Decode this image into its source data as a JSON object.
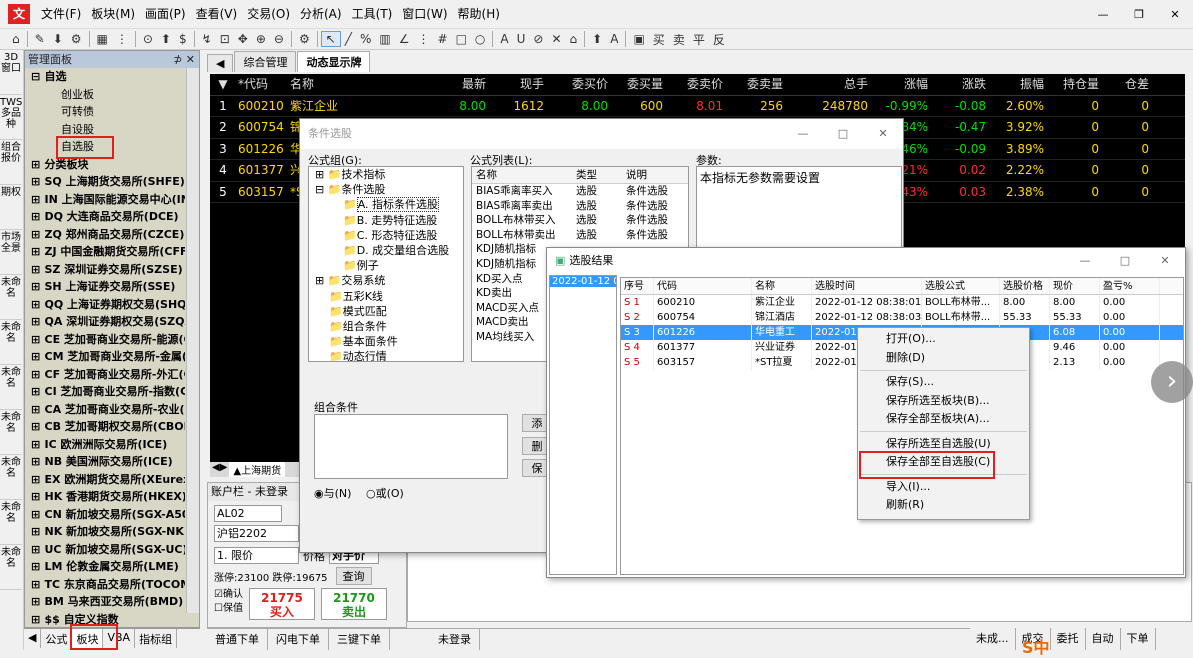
{
  "app": {
    "logo": "文"
  },
  "menu": [
    "文件(F)",
    "板块(M)",
    "画面(P)",
    "查看(V)",
    "交易(O)",
    "分析(A)",
    "工具(T)",
    "窗口(W)",
    "帮助(H)"
  ],
  "toolbar": [
    "⌂",
    "✎",
    "⬇",
    "⚙",
    "▦",
    "⋮",
    "⊙",
    "⬆",
    "$",
    "↯",
    "⊡",
    "✥",
    "⊕",
    "⊖",
    "⚙",
    "↖",
    "╱",
    "%",
    "▥",
    "∠",
    "⋮",
    "#",
    "□",
    "○",
    "A",
    "U",
    "⊘",
    "✕",
    "⌂",
    "⬆",
    "A",
    "▣",
    "买",
    "卖",
    "平",
    "反"
  ],
  "vtabs": [
    "3D窗口",
    "TWS多品种",
    "组合报价",
    "期权",
    "市场全景",
    "未命名",
    "未命名",
    "未命名",
    "未命名",
    "未命名",
    "未命名",
    "未命名"
  ],
  "panel": {
    "title": "管理面板",
    "pin": "⊅ ✕",
    "tree": [
      {
        "t": "自选",
        "ex": "⊟",
        "lvl": 0
      },
      {
        "t": "创业板",
        "lvl": 1
      },
      {
        "t": "可转债",
        "lvl": 1
      },
      {
        "t": "自设股",
        "lvl": 1
      },
      {
        "t": "自选股",
        "lvl": 1
      },
      {
        "t": "分类板块",
        "ex": "⊞",
        "lvl": 0
      },
      {
        "t": "SQ 上海期货交易所(SHFE)",
        "ex": "⊞",
        "lvl": 0
      },
      {
        "t": "IN 上海国际能源交易中心(INE)",
        "ex": "⊞",
        "lvl": 0
      },
      {
        "t": "DQ 大连商品交易所(DCE)",
        "ex": "⊞",
        "lvl": 0
      },
      {
        "t": "ZQ 郑州商品交易所(CZCE)",
        "ex": "⊞",
        "lvl": 0
      },
      {
        "t": "ZJ 中国金融期货交易所(CFFEX)",
        "ex": "⊞",
        "lvl": 0
      },
      {
        "t": "SZ 深圳证券交易所(SZSE)",
        "ex": "⊞",
        "lvl": 0
      },
      {
        "t": "SH 上海证券交易所(SSE)",
        "ex": "⊞",
        "lvl": 0
      },
      {
        "t": "QQ 上海证券期权交易(SHQQ)",
        "ex": "⊞",
        "lvl": 0
      },
      {
        "t": "QA 深圳证券期权交易(SZQA)",
        "ex": "⊞",
        "lvl": 0
      },
      {
        "t": "CE 芝加哥商业交易所-能源(CM",
        "ex": "⊞",
        "lvl": 0
      },
      {
        "t": "CM 芝加哥商业交易所-金属(CM",
        "ex": "⊞",
        "lvl": 0
      },
      {
        "t": "CF 芝加哥商业交易所-外汇(CM",
        "ex": "⊞",
        "lvl": 0
      },
      {
        "t": "CI 芝加哥商业交易所-指数(CM",
        "ex": "⊞",
        "lvl": 0
      },
      {
        "t": "CA 芝加哥商业交易所-农业(CM",
        "ex": "⊞",
        "lvl": 0
      },
      {
        "t": "CB 芝加哥期权交易所(CBOE)",
        "ex": "⊞",
        "lvl": 0
      },
      {
        "t": "IC 欧洲洲际交易所(ICE)",
        "ex": "⊞",
        "lvl": 0
      },
      {
        "t": "NB 美国洲际交易所(ICE)",
        "ex": "⊞",
        "lvl": 0
      },
      {
        "t": "EX 欧洲期货交易所(XEurex)",
        "ex": "⊞",
        "lvl": 0
      },
      {
        "t": "HK 香港期货交易所(HKEX)",
        "ex": "⊞",
        "lvl": 0
      },
      {
        "t": "CN 新加坡交易所(SGX-A50)",
        "ex": "⊞",
        "lvl": 0
      },
      {
        "t": "NK 新加坡交易所(SGX-NK)",
        "ex": "⊞",
        "lvl": 0
      },
      {
        "t": "UC 新加坡交易所(SGX-UC)",
        "ex": "⊞",
        "lvl": 0
      },
      {
        "t": "LM 伦敦金属交易所(LME)",
        "ex": "⊞",
        "lvl": 0
      },
      {
        "t": "TC 东京商品交易所(TOCOM)",
        "ex": "⊞",
        "lvl": 0
      },
      {
        "t": "BM 马来西亚交易所(BMD)",
        "ex": "⊞",
        "lvl": 0
      },
      {
        "t": "$$ 自定义指数",
        "ex": "⊞",
        "lvl": 0
      }
    ],
    "tabs": [
      "公式",
      "板块",
      "VBA",
      "指标组"
    ]
  },
  "maintabs": [
    "综合管理",
    "动态显示牌"
  ],
  "grid": {
    "headers": [
      "▼",
      "*代码",
      "名称",
      "最新",
      "现手",
      "委买价",
      "委买量",
      "委卖价",
      "委卖量",
      "总手",
      "涨幅",
      "涨跌",
      "振幅",
      "持仓量",
      "仓差"
    ],
    "rows": [
      [
        "1",
        "600210",
        "紫江企业",
        "8.00",
        "1612",
        "8.00",
        "600",
        "8.01",
        "256",
        "248780",
        "-0.99%",
        "-0.08",
        "2.60%",
        "0",
        "0"
      ],
      [
        "2",
        "600754",
        "锦江酒店",
        "",
        "",
        "",
        "",
        "",
        "",
        "",
        "-0.84%",
        "-0.47",
        "3.92%",
        "0",
        "0"
      ],
      [
        "3",
        "601226",
        "华电重工",
        "",
        "",
        "",
        "",
        "",
        "",
        "",
        "-1.46%",
        "-0.09",
        "3.89%",
        "0",
        "0"
      ],
      [
        "4",
        "601377",
        "兴业证券",
        "",
        "",
        "",
        "",
        "",
        "",
        "",
        "0.21%",
        "0.02",
        "2.22%",
        "0",
        "0"
      ],
      [
        "5",
        "603157",
        "*ST拉夏",
        "",
        "",
        "",
        "",
        "",
        "",
        "",
        "1.43%",
        "0.03",
        "2.38%",
        "0",
        "0"
      ]
    ],
    "frag": [
      "0",
      "0",
      "5",
      "1",
      "8"
    ],
    "subtab": "▲上海期货"
  },
  "account": {
    "title": "账户栏 - 未登录",
    "code": "AL02",
    "name": "沪铝2202",
    "ordertype": "1. 限价",
    "price_label": "价格",
    "price_val": "对手价",
    "limit": "涨停:23100 跌停:19675",
    "query": "查询",
    "confirm": "确认",
    "keep": "保值",
    "buy_price": "21775",
    "sell_price": "21770",
    "buy": "买入",
    "sell": "卖出"
  },
  "bottabs": [
    "普通下单",
    "闪电下单",
    "三键下单",
    "未登录"
  ],
  "righttabs": [
    "未成...",
    "成交",
    "委托",
    "自动",
    "下单"
  ],
  "cond": {
    "title": "条件选股",
    "group_label": "公式组(G):",
    "list_label": "公式列表(L):",
    "param_label": "参数:",
    "param_text": "本指标无参数需要设置",
    "combo_label": "组合条件",
    "and": "与(N)",
    "or": "或(O)",
    "add": "添",
    "del": "删",
    "save": "保",
    "groups": [
      {
        "t": "技术指标",
        "l": 1,
        "ex": "⊞"
      },
      {
        "t": "条件选股",
        "l": 1,
        "ex": "⊟"
      },
      {
        "t": "A. 指标条件选股",
        "l": 3
      },
      {
        "t": "B. 走势特征选股",
        "l": 3
      },
      {
        "t": "C. 形态特征选股",
        "l": 3
      },
      {
        "t": "D. 成交量组合选股",
        "l": 3
      },
      {
        "t": "例子",
        "l": 3
      },
      {
        "t": "交易系统",
        "l": 1,
        "ex": "⊞"
      },
      {
        "t": "五彩K线",
        "l": 2
      },
      {
        "t": "模式匹配",
        "l": 2
      },
      {
        "t": "组合条件",
        "l": 2
      },
      {
        "t": "基本面条件",
        "l": 2
      },
      {
        "t": "动态行情",
        "l": 2
      }
    ],
    "list_headers": [
      "名称",
      "类型",
      "说明"
    ],
    "list": [
      [
        "BIAS乖离率买入",
        "选股",
        "条件选股"
      ],
      [
        "BIAS乖离率卖出",
        "选股",
        "条件选股"
      ],
      [
        "BOLL布林带买入",
        "选股",
        "条件选股"
      ],
      [
        "BOLL布林带卖出",
        "选股",
        "条件选股"
      ],
      [
        "KDJ随机指标",
        "",
        ""
      ],
      [
        "KDJ随机指标",
        "",
        ""
      ],
      [
        "KD买入点",
        "",
        ""
      ],
      [
        "KD卖出",
        "",
        ""
      ],
      [
        "MACD买入点",
        "",
        ""
      ],
      [
        "MACD卖出",
        "",
        ""
      ],
      [
        "MA均线买入",
        "",
        ""
      ]
    ]
  },
  "result": {
    "title": "选股结果",
    "date": "2022-01-12 0",
    "headers": [
      "序号",
      "代码",
      "名称",
      "选股时间",
      "选股公式",
      "选股价格",
      "现价",
      "盈亏%"
    ],
    "rows": [
      [
        "S 1",
        "600210",
        "紫江企业",
        "2022-01-12 08:38:01",
        "BOLL布林带...",
        "8.00",
        "8.00",
        "0.00"
      ],
      [
        "S 2",
        "600754",
        "锦江酒店",
        "2022-01-12 08:38:03",
        "BOLL布林带...",
        "55.33",
        "55.33",
        "0.00"
      ],
      [
        "S 3",
        "601226",
        "华电重工",
        "2022-01-",
        "",
        "",
        "6.08",
        "0.00"
      ],
      [
        "S 4",
        "601377",
        "兴业证券",
        "2022-01-",
        "",
        "",
        "9.46",
        "0.00"
      ],
      [
        "S 5",
        "603157",
        "*ST拉夏",
        "2022-01-",
        "",
        "",
        "2.13",
        "0.00"
      ]
    ]
  },
  "context_menu": [
    [
      "打开(O)...",
      "删除(D)"
    ],
    [
      "保存(S)...",
      "保存所选至板块(B)...",
      "保存全部至板块(A)..."
    ],
    [
      "保存所选至自选股(U)",
      "保存全部至自选股(C)"
    ],
    [
      "导入(I)...",
      "刷新(R)"
    ]
  ],
  "colors": {
    "grid_bg": "#000000",
    "price_red": "#ff3030",
    "price_green": "#00e000",
    "code_yellow": "#ffd800",
    "highlight": "#e02020"
  },
  "taskbar": "S中"
}
